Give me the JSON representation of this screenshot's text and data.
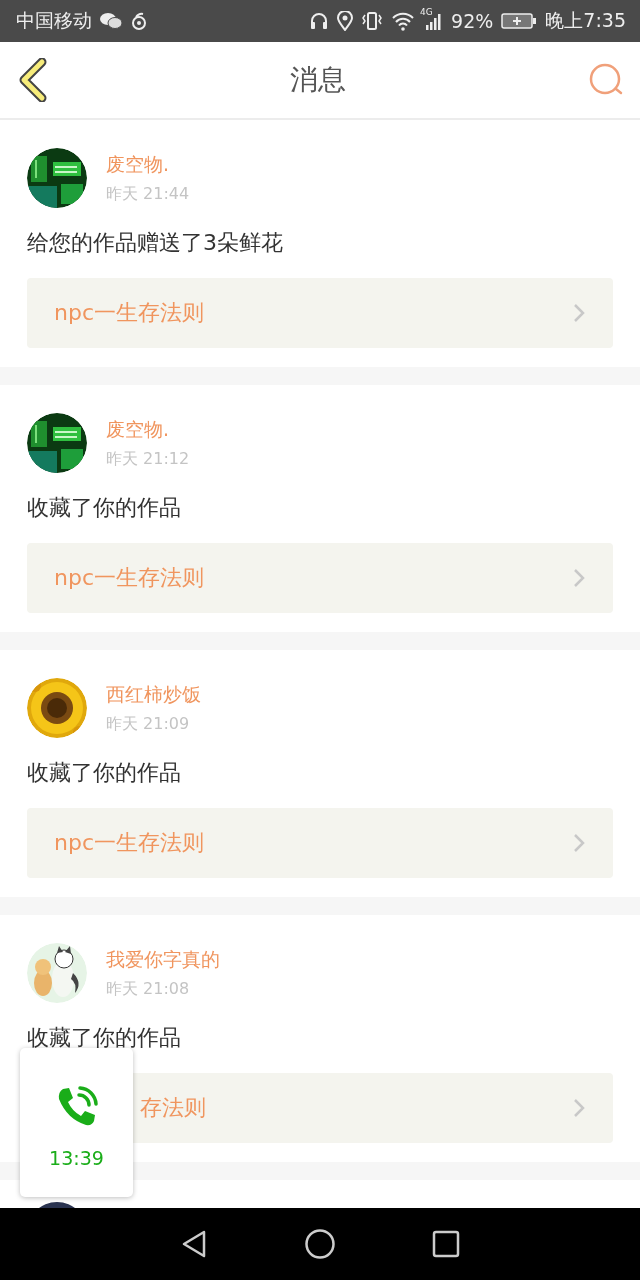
{
  "status_bar": {
    "carrier": "中国移动",
    "network": "4G",
    "battery": "92%",
    "time": "晚上7:35"
  },
  "header": {
    "title": "消息"
  },
  "messages": [
    {
      "name": "废空物.",
      "time": "昨天 21:44",
      "text": "给您的作品赠送了3朵鲜花",
      "work": "npc一生存法则",
      "partly_hidden": false
    },
    {
      "name": "废空物.",
      "time": "昨天 21:12",
      "text": "收藏了你的作品",
      "work": "npc一生存法则",
      "partly_hidden": false
    },
    {
      "name": "西红柿炒饭",
      "time": "昨天 21:09",
      "text": "收藏了你的作品",
      "work": "npc一生存法则",
      "partly_hidden": false
    },
    {
      "name": "我爱你字真的",
      "time": "昨天 21:08",
      "text": "收藏了你的作品",
      "work": "存法则",
      "partly_hidden": true
    }
  ],
  "call_float": {
    "duration": "13:39"
  }
}
